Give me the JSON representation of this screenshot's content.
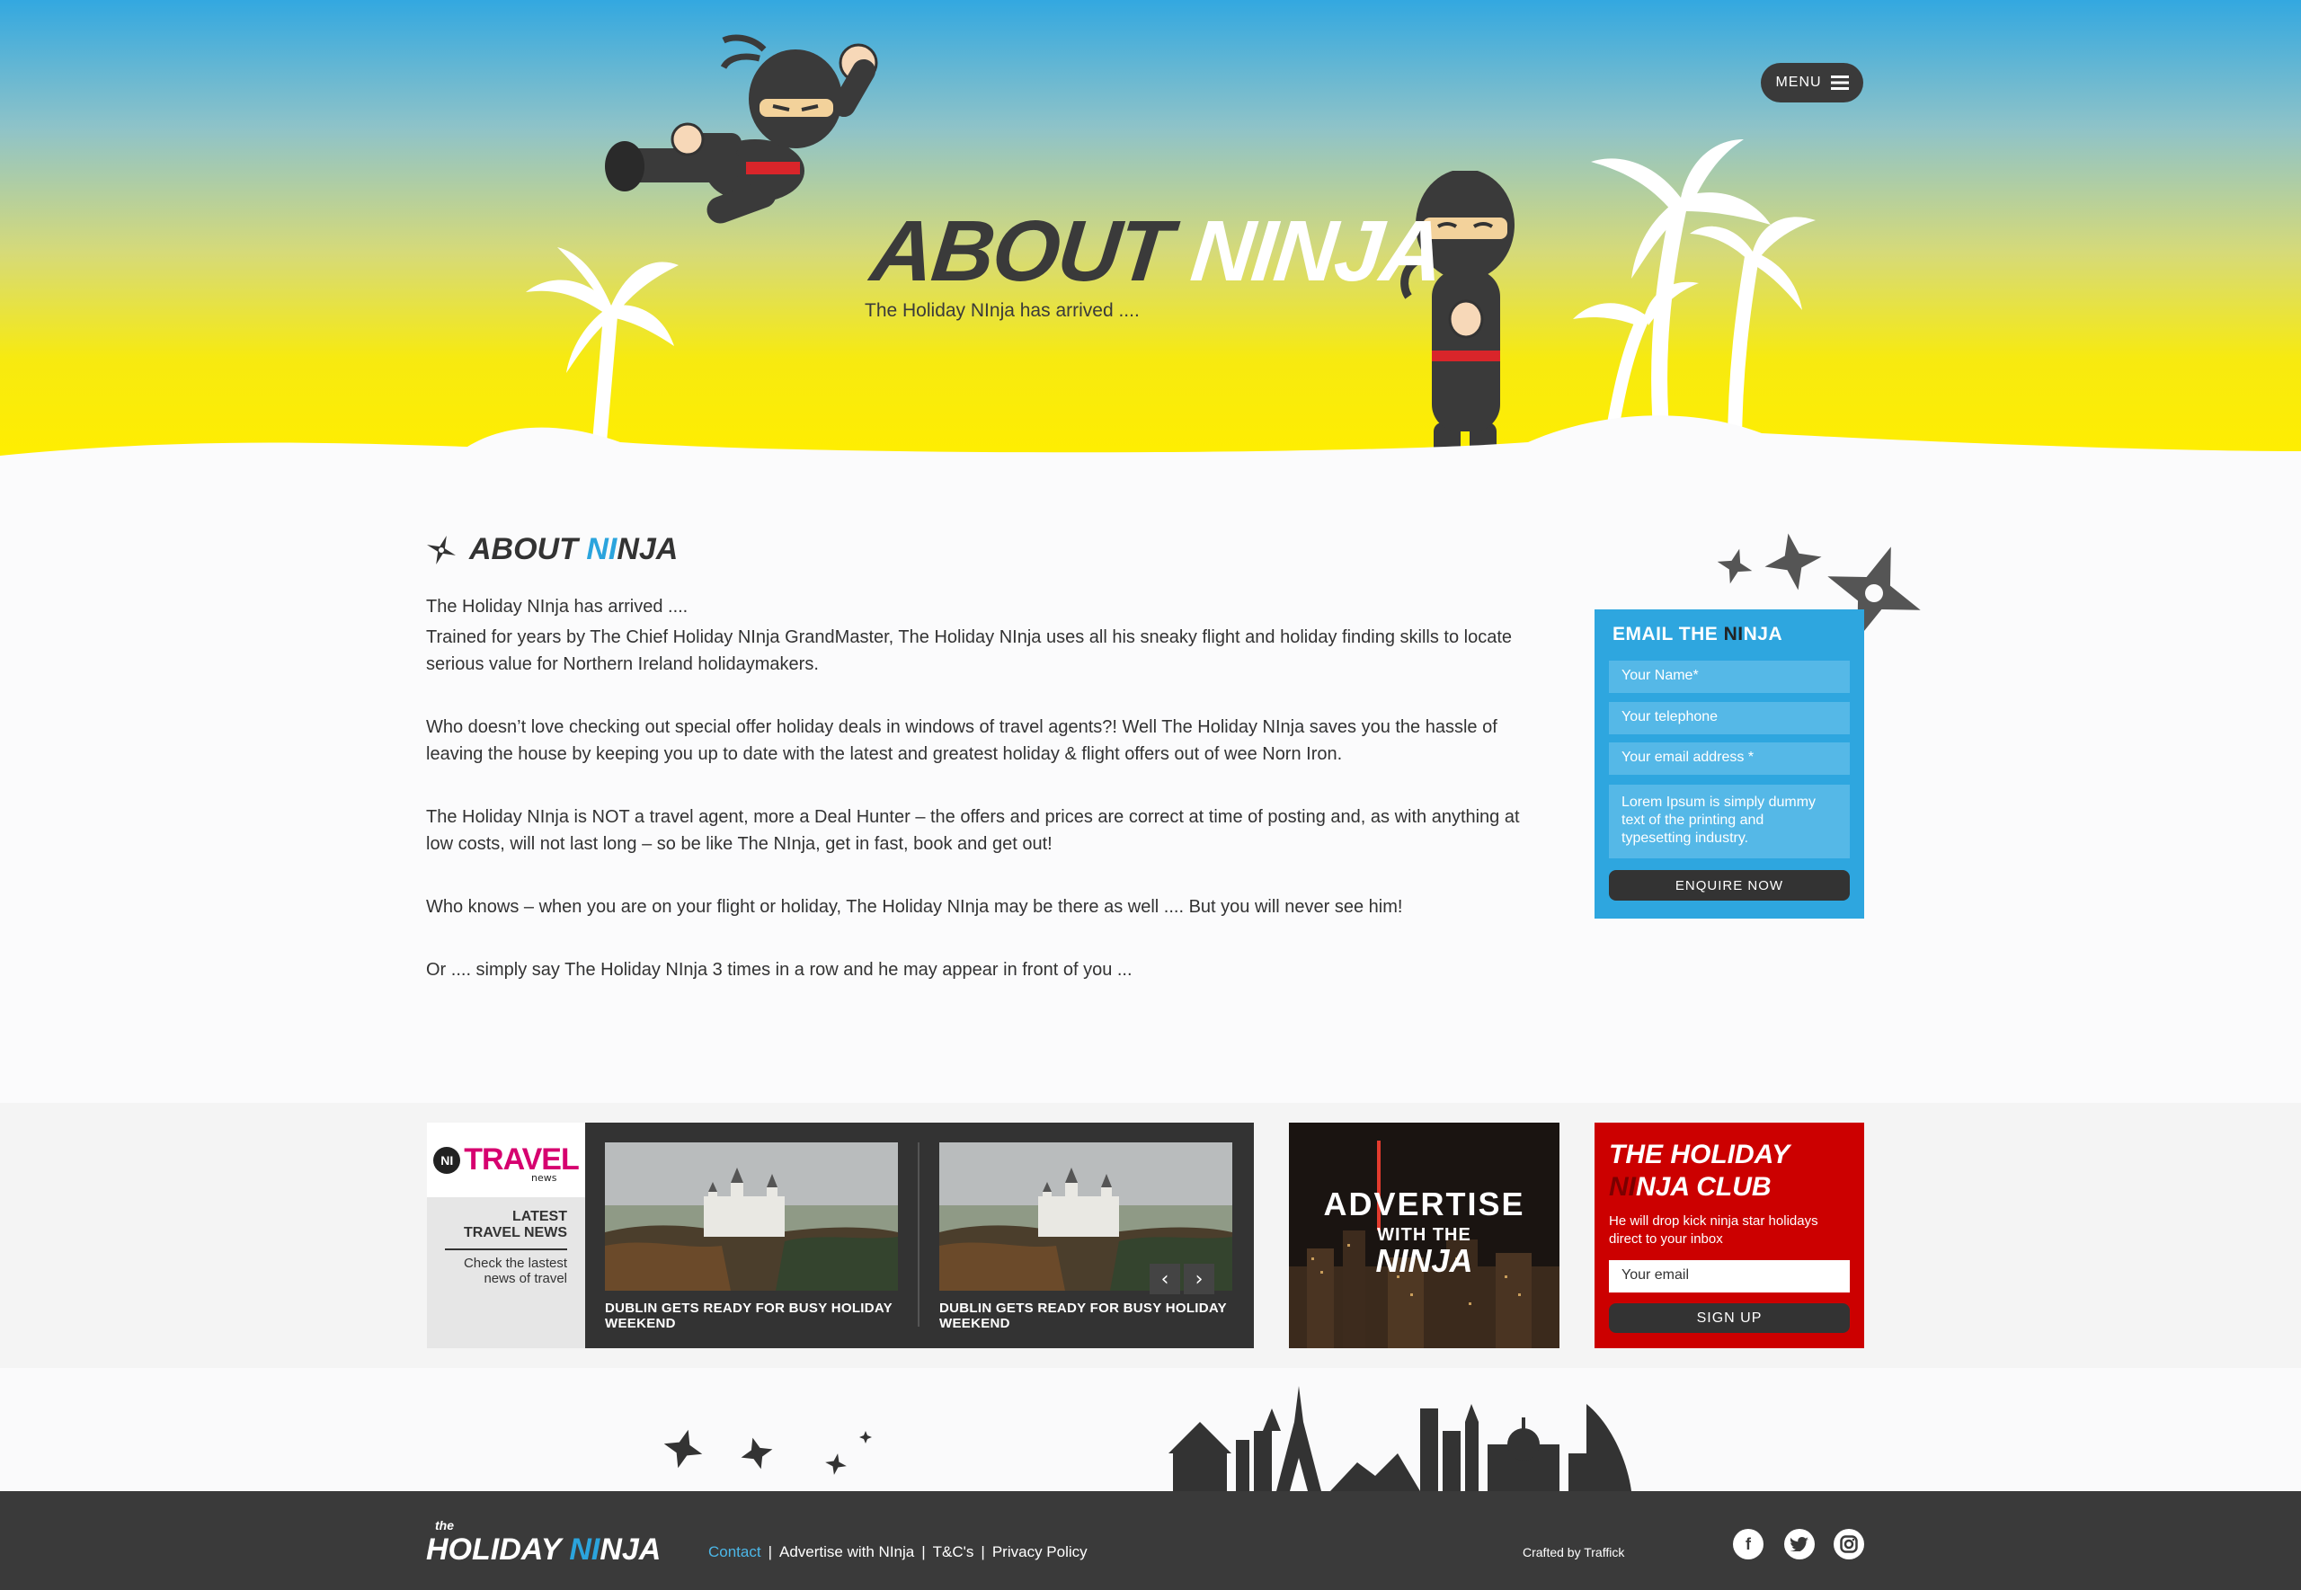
{
  "colors": {
    "accent": "#2ea6df",
    "club_red": "#cc0000",
    "dark": "#3a3a3a",
    "yellow": "#ffee00"
  },
  "header": {
    "menu_label": "MENU",
    "title_about": "ABOUT",
    "title_ni": "NI",
    "title_nja": "NJA",
    "subtitle": "The Holiday NInja has arrived ...."
  },
  "about": {
    "heading_about": "ABOUT",
    "heading_ni": "NI",
    "heading_nja": "NJA",
    "paragraphs": [
      "The Holiday NInja has arrived ....",
      "Trained for years by The Chief Holiday NInja GrandMaster, The Holiday NInja uses all his sneaky flight and holiday finding skills to locate serious value for Northern Ireland holidaymakers.",
      "Who doesn’t love checking out special offer holiday deals in windows of travel agents?! Well The Holiday NInja saves you the hassle of leaving the house by keeping you up to date with the latest and greatest holiday & flight offers out of wee Norn Iron.",
      "The Holiday NInja is NOT a travel agent, more a Deal Hunter – the offers and prices are correct at time of posting and, as with anything at low costs, will not last long – so be like The NInja, get in fast, book and get out!",
      "Who knows – when you are on your flight or holiday, The Holiday NInja may be there as well .... But you will never see him!",
      "Or .... simply say The Holiday NInja 3 times in a row and he may appear in front of you ..."
    ]
  },
  "email_form": {
    "title_pre": "EMAIL THE ",
    "title_ni": "NI",
    "title_post": "NJA",
    "name_placeholder": "Your Name*",
    "phone_placeholder": "Your telephone",
    "email_placeholder": "Your email address *",
    "message_placeholder": "Lorem Ipsum is simply dummy text of the printing and typesetting industry.",
    "submit_label": "ENQUIRE NOW"
  },
  "news": {
    "logo_ni": "NI",
    "logo_travel": "TRAVEL",
    "logo_sub": "news",
    "latest_line1": "LATEST",
    "latest_line2": "TRAVEL NEWS",
    "check_text": "Check the lastest news of travel",
    "cards": [
      {
        "title": "DUBLIN GETS READY FOR BUSY HOLIDAY WEEKEND"
      },
      {
        "title": "DUBLIN GETS READY FOR BUSY HOLIDAY WEEKEND"
      }
    ],
    "prev_icon": "chevron-left-icon",
    "next_icon": "chevron-right-icon"
  },
  "advertise": {
    "line1": "ADVERTISE",
    "line2": "WITH THE",
    "line3": "NINJA"
  },
  "club": {
    "title_pre": "THE HOLIDAY ",
    "title_ni": "NI",
    "title_post": "NJA CLUB",
    "description": "He will drop kick ninja star holidays direct to your inbox",
    "email_placeholder": "Your email",
    "submit_label": "SIGN UP"
  },
  "footer": {
    "logo_the": "the",
    "logo_holiday": "HOLIDAY ",
    "logo_ni": "NI",
    "logo_nja": "NJA",
    "links": [
      "Contact",
      "Advertise with NInja",
      "T&C's",
      "Privacy Policy"
    ],
    "crafted": "Crafted by Traffick",
    "social": [
      "facebook-icon",
      "twitter-icon",
      "instagram-icon"
    ]
  }
}
